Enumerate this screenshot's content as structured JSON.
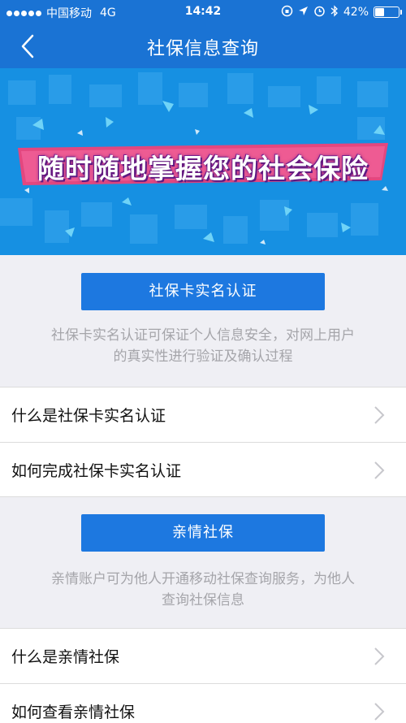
{
  "status": {
    "carrier": "中国移动",
    "network": "4G",
    "time": "14:42",
    "battery_percent": "42%",
    "battery_level": 0.42
  },
  "nav": {
    "title": "社保信息查询"
  },
  "banner": {
    "text": "随时随地掌握您的社会保险"
  },
  "sections": [
    {
      "button_label": "社保卡实名认证",
      "description_lines": [
        "社保卡实名认证可保证个人信息安全，对网上用户",
        "的真实性进行验证及确认过程"
      ],
      "items": [
        "什么是社保卡实名认证",
        "如何完成社保卡实名认证"
      ]
    },
    {
      "button_label": "亲情社保",
      "description_lines": [
        "亲情账户可为他人开通移动社保查询服务，为他人",
        "查询社保信息"
      ],
      "items": [
        "什么是亲情社保",
        "如何查看亲情社保"
      ]
    }
  ],
  "colors": {
    "header": "#1a73d4",
    "button": "#1d78e0",
    "background": "#efeff4",
    "ribbon": "#e3477f"
  }
}
